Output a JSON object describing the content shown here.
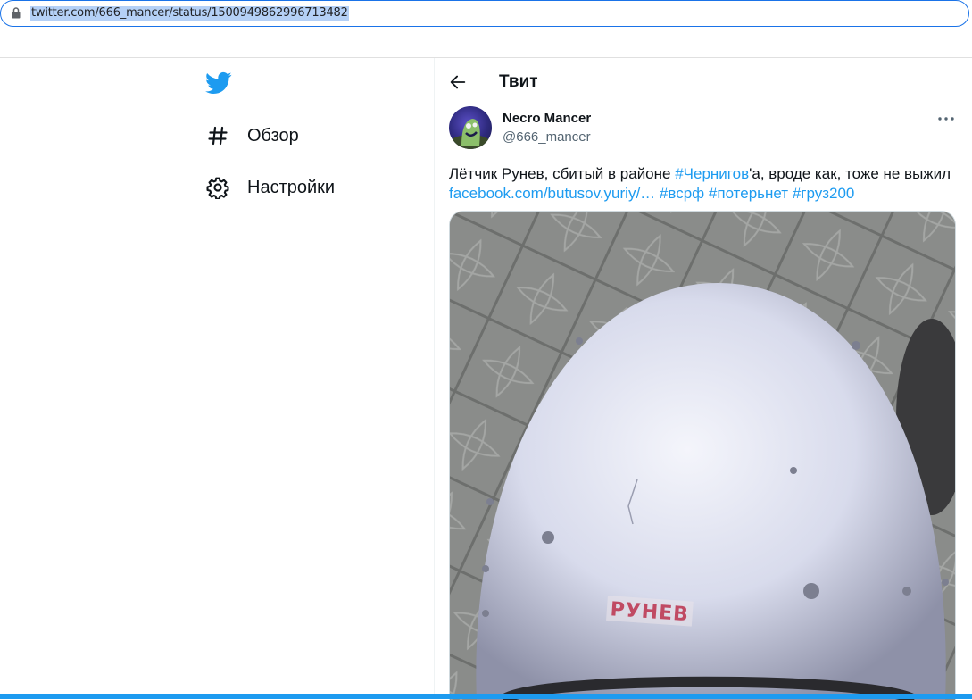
{
  "browser": {
    "url": "twitter.com/666_mancer/status/1500949862996713482"
  },
  "sidebar": {
    "items": [
      {
        "label": "Обзор",
        "icon": "hashtag-icon"
      },
      {
        "label": "Настройки",
        "icon": "gear-icon"
      }
    ]
  },
  "header": {
    "title": "Твит"
  },
  "tweet": {
    "author_name": "Necro Mancer",
    "author_handle": "@666_mancer",
    "text_part1": "Лётчик Рунев, сбитый в районе ",
    "hashtag_chernigov": "#Чернигов",
    "text_part2": "'а, вроде как, тоже не выжил",
    "link": "facebook.com/butusov.yuriy/…",
    "hashtags": [
      "#всрф",
      "#потерьнет",
      "#груз200"
    ],
    "helmet_text": "РУНЕВ"
  },
  "colors": {
    "accent": "#1d9bf0",
    "text": "#0f1419",
    "muted": "#536471"
  }
}
